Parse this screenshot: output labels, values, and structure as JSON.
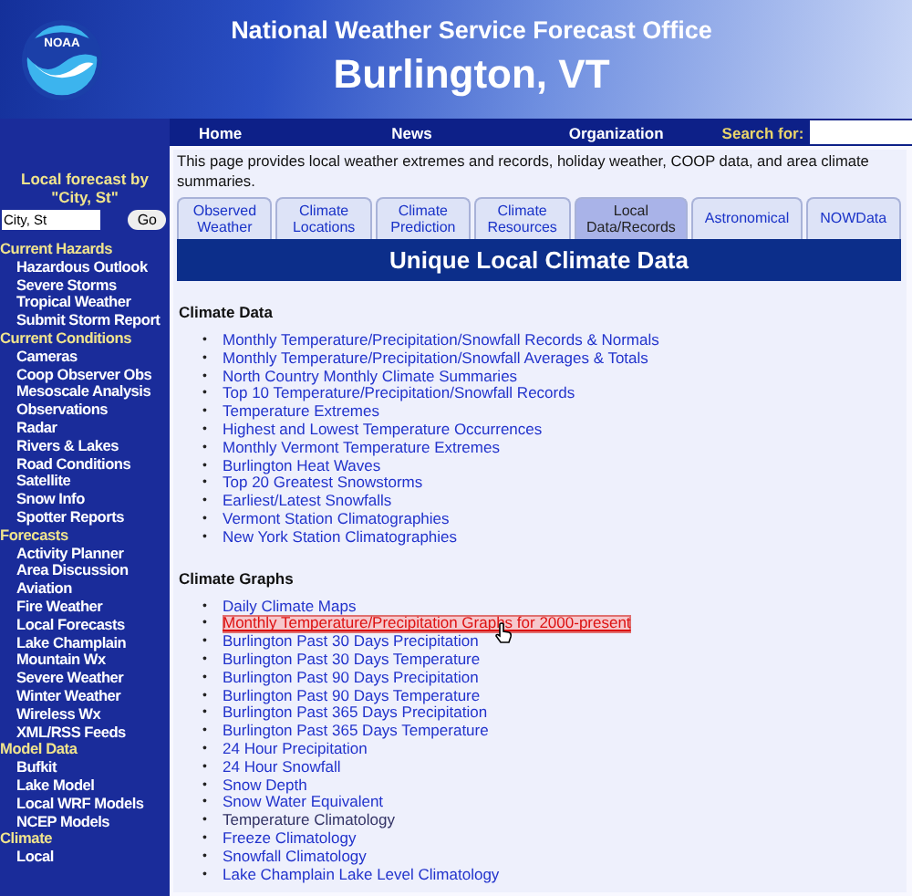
{
  "header": {
    "logo_text": "NOAA",
    "agency": "National Weather Service Forecast Office",
    "office": "Burlington, VT"
  },
  "nav": {
    "links": [
      "Home",
      "News",
      "Organization"
    ],
    "search_label": "Search for:"
  },
  "sidebar": {
    "forecast_label": "Local forecast by \"City, St\"",
    "city_field": {
      "value": "City, St"
    },
    "go_button": "Go",
    "sections": [
      {
        "title": "Current Hazards",
        "items": [
          "Hazardous Outlook",
          "Severe Storms",
          "Tropical Weather",
          "Submit Storm Report"
        ]
      },
      {
        "title": "Current Conditions",
        "items": [
          "Cameras",
          "Coop Observer Obs",
          "Mesoscale Analysis",
          "Observations",
          "Radar",
          "Rivers & Lakes",
          "Road Conditions",
          "Satellite",
          "Snow Info",
          "Spotter Reports"
        ]
      },
      {
        "title": "Forecasts",
        "items": [
          "Activity Planner",
          "Area Discussion",
          "Aviation",
          "Fire Weather",
          "Local Forecasts",
          "Lake Champlain",
          "Mountain Wx",
          "Severe Weather",
          "Winter Weather",
          "Wireless Wx",
          "XML/RSS Feeds"
        ]
      },
      {
        "title": "Model Data",
        "items": [
          "Bufkit",
          "Lake Model",
          "Local WRF Models",
          "NCEP Models"
        ]
      },
      {
        "title": "Climate",
        "items": [
          "Local"
        ]
      }
    ]
  },
  "intro": "This page provides local weather extremes and records, holiday weather, COOP data, and area climate summaries.",
  "tabs": [
    {
      "label": "Observed Weather",
      "selected": false
    },
    {
      "label": "Climate Locations",
      "selected": false
    },
    {
      "label": "Climate Prediction",
      "selected": false
    },
    {
      "label": "Climate Resources",
      "selected": false
    },
    {
      "label": "Local Data/Records",
      "selected": true
    },
    {
      "label": "Astronomical",
      "selected": false
    },
    {
      "label": "NOWData",
      "selected": false
    }
  ],
  "banner": "Unique Local Climate Data",
  "sections": [
    {
      "title": "Climate Data",
      "bullet": "•",
      "links": [
        {
          "text": "Monthly Temperature/Precipitation/Snowfall Records & Normals",
          "hovered": false,
          "visited": false
        },
        {
          "text": "Monthly Temperature/Precipitation/Snowfall Averages & Totals",
          "hovered": false,
          "visited": false
        },
        {
          "text": "North Country Monthly Climate Summaries",
          "hovered": false,
          "visited": false
        },
        {
          "text": "Top 10 Temperature/Precipitation/Snowfall Records",
          "hovered": false,
          "visited": false
        },
        {
          "text": "Temperature Extremes",
          "hovered": false,
          "visited": false
        },
        {
          "text": "Highest and Lowest Temperature Occurrences",
          "hovered": false,
          "visited": false
        },
        {
          "text": "Monthly Vermont Temperature Extremes",
          "hovered": false,
          "visited": false
        },
        {
          "text": "Burlington Heat Waves",
          "hovered": false,
          "visited": false
        },
        {
          "text": "Top 20 Greatest Snowstorms",
          "hovered": false,
          "visited": false
        },
        {
          "text": "Earliest/Latest Snowfalls",
          "hovered": false,
          "visited": false
        },
        {
          "text": "Vermont Station Climatographies",
          "hovered": false,
          "visited": false
        },
        {
          "text": "New York Station Climatographies",
          "hovered": false,
          "visited": false
        }
      ]
    },
    {
      "title": "Climate Graphs",
      "bullet": "•",
      "links": [
        {
          "text": "Daily Climate Maps",
          "hovered": false,
          "visited": false
        },
        {
          "text": "Monthly Temperature/Precipitation Graphs for 2000-present",
          "hovered": true,
          "visited": false
        },
        {
          "text": "Burlington Past 30 Days Precipitation",
          "hovered": false,
          "visited": false
        },
        {
          "text": "Burlington Past 30 Days Temperature",
          "hovered": false,
          "visited": false
        },
        {
          "text": "Burlington Past 90 Days Precipitation",
          "hovered": false,
          "visited": false
        },
        {
          "text": "Burlington Past 90 Days Temperature",
          "hovered": false,
          "visited": false
        },
        {
          "text": "Burlington Past 365 Days Precipitation",
          "hovered": false,
          "visited": false
        },
        {
          "text": "Burlington Past 365 Days Temperature",
          "hovered": false,
          "visited": false
        },
        {
          "text": "24 Hour Precipitation",
          "hovered": false,
          "visited": false
        },
        {
          "text": "24 Hour Snowfall",
          "hovered": false,
          "visited": false
        },
        {
          "text": "Snow Depth",
          "hovered": false,
          "visited": false
        },
        {
          "text": "Snow Water Equivalent",
          "hovered": false,
          "visited": false
        },
        {
          "text": "Temperature Climatology",
          "hovered": false,
          "visited": true
        },
        {
          "text": "Freeze Climatology",
          "hovered": false,
          "visited": false
        },
        {
          "text": "Snowfall Climatology",
          "hovered": false,
          "visited": false
        },
        {
          "text": "Lake Champlain Lake Level Climatology",
          "hovered": false,
          "visited": false
        }
      ]
    }
  ]
}
